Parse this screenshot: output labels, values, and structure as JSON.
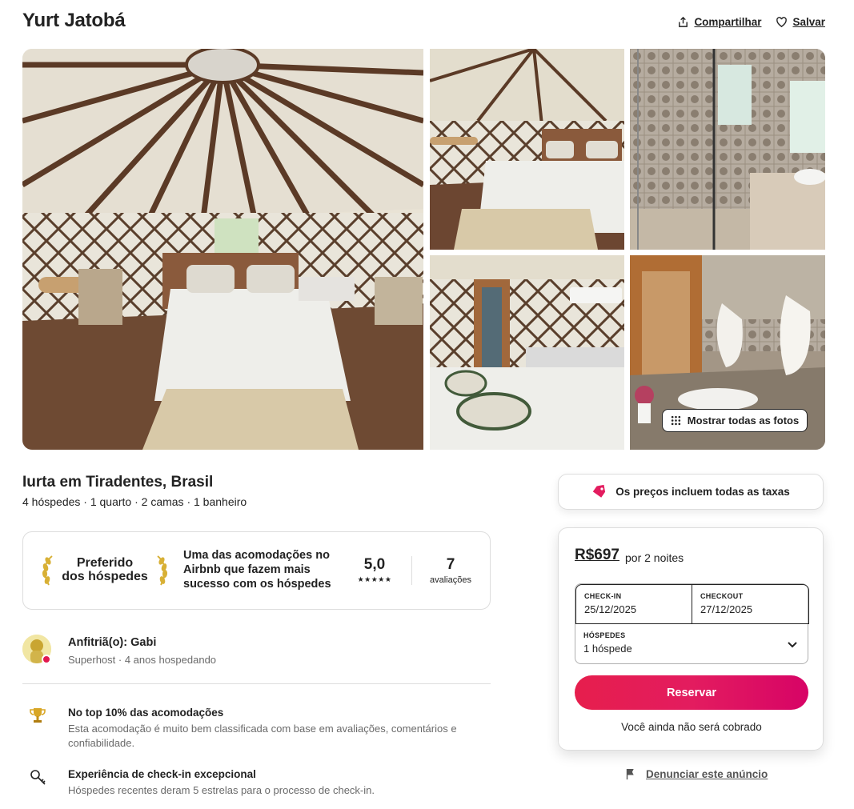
{
  "listing": {
    "title": "Yurt Jatobá",
    "share_label": "Compartilhar",
    "save_label": "Salvar",
    "show_all_photos": "Mostrar todas as fotos",
    "subtitle": "Iurta em Tiradentes, Brasil",
    "specs": "4 hóspedes · 1 quarto · 2 camas · 1 banheiro"
  },
  "guest_favorite": {
    "label_line1": "Preferido",
    "label_line2": "dos hóspedes",
    "description": "Uma das acomodações no Airbnb que fazem mais sucesso com os hóspedes",
    "rating": "5,0",
    "stars": "★★★★★",
    "reviews_count": "7",
    "reviews_label": "avaliações"
  },
  "host": {
    "name": "Anfitriã(o): Gabi",
    "details": "Superhost · 4 anos hospedando"
  },
  "highlights": [
    {
      "icon": "trophy-icon",
      "title": "No top 10% das acomodações",
      "description": "Esta acomodação é muito bem classificada com base em avaliações, comentários e confiabilidade."
    },
    {
      "icon": "key-icon",
      "title": "Experiência de check-in excepcional",
      "description": "Hóspedes recentes deram 5 estrelas para o processo de check-in."
    }
  ],
  "booking": {
    "tax_notice": "Os preços incluem todas as taxas",
    "price": "R$697",
    "price_period": "por 2 noites",
    "checkin_label": "CHECK-IN",
    "checkin_value": "25/12/2025",
    "checkout_label": "CHECKOUT",
    "checkout_value": "27/12/2025",
    "guests_label": "HÓSPEDES",
    "guests_value": "1 hóspede",
    "reserve_label": "Reservar",
    "not_charged": "Você ainda não será cobrado"
  },
  "report_label": "Denunciar este anúncio",
  "colors": {
    "brand": "#e31c5f",
    "text": "#222222",
    "muted": "#6a6a6a",
    "border": "#dddddd"
  }
}
